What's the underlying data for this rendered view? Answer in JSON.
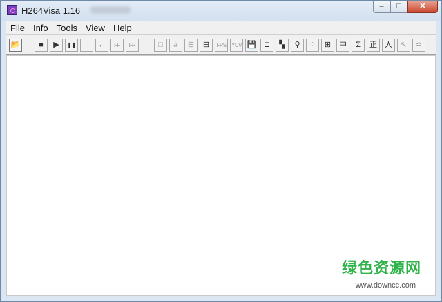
{
  "window": {
    "title": "H264Visa 1.16"
  },
  "caption_buttons": {
    "minimize": "–",
    "maximize": "□",
    "close": "✕"
  },
  "menu": {
    "items": [
      "File",
      "Info",
      "Tools",
      "View",
      "Help"
    ]
  },
  "toolbar": {
    "buttons": [
      {
        "name": "open-folder-icon",
        "glyph": "📂"
      },
      {
        "name": "stop-icon",
        "glyph": "■"
      },
      {
        "name": "play-icon",
        "glyph": "▶"
      },
      {
        "name": "pause-icon",
        "glyph": "❚❚"
      },
      {
        "name": "next-frame-icon",
        "glyph": "→"
      },
      {
        "name": "prev-frame-icon",
        "glyph": "←"
      },
      {
        "name": "fast-forward-label",
        "glyph": "FF"
      },
      {
        "name": "fast-rewind-label",
        "glyph": "FR"
      },
      {
        "name": "square-icon",
        "glyph": "□"
      },
      {
        "name": "grid-icon",
        "glyph": "#"
      },
      {
        "name": "macroblock-icon",
        "glyph": "⊞"
      },
      {
        "name": "split-icon",
        "glyph": "⊟"
      },
      {
        "name": "fps-label",
        "glyph": "FPS"
      },
      {
        "name": "yuv-icon",
        "glyph": "YUV"
      },
      {
        "name": "save-icon",
        "glyph": "💾"
      },
      {
        "name": "crop-icon",
        "glyph": "⊐"
      },
      {
        "name": "checker-icon",
        "glyph": "▚"
      },
      {
        "name": "binoculars-icon",
        "glyph": "⚲"
      },
      {
        "name": "dots-icon",
        "glyph": "⁘"
      },
      {
        "name": "window-icon",
        "glyph": "⊞"
      },
      {
        "name": "middle-icon",
        "glyph": "中"
      },
      {
        "name": "sigma-icon",
        "glyph": "Σ"
      },
      {
        "name": "correct-icon",
        "glyph": "正"
      },
      {
        "name": "person-icon",
        "glyph": "人"
      },
      {
        "name": "arrow-corner-icon",
        "glyph": "↖"
      },
      {
        "name": "wave-icon",
        "glyph": "≏"
      }
    ]
  },
  "watermark": {
    "text": "绿色资源网",
    "url": "www.downcc.com"
  }
}
